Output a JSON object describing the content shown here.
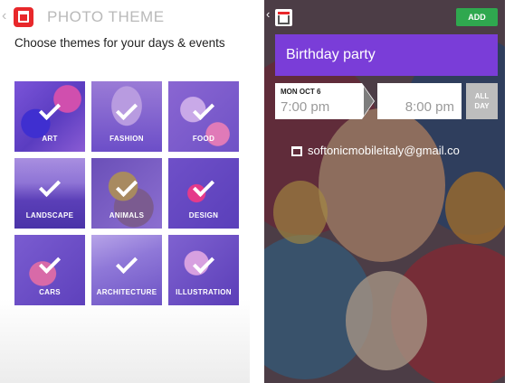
{
  "left_screen": {
    "title": "PHOTO THEME",
    "subtitle": "Choose themes for your days & events",
    "themes": [
      {
        "label": "ART",
        "selected": true
      },
      {
        "label": "FASHION",
        "selected": true
      },
      {
        "label": "FOOD",
        "selected": true
      },
      {
        "label": "LANDSCAPE",
        "selected": true
      },
      {
        "label": "ANIMALS",
        "selected": true
      },
      {
        "label": "DESIGN",
        "selected": true
      },
      {
        "label": "CARS",
        "selected": true
      },
      {
        "label": "ARCHITECTURE",
        "selected": true
      },
      {
        "label": "ILLUSTRATION",
        "selected": true
      }
    ]
  },
  "right_screen": {
    "add_label": "ADD",
    "event_title": "Birthday party",
    "date": "MON OCT 6",
    "start_time": "7:00 pm",
    "end_time": "8:00 pm",
    "all_day_line1": "ALL",
    "all_day_line2": "DAY",
    "account": "softonicmobileitaly@gmail.co"
  },
  "colors": {
    "brand_red": "#e8282b",
    "accent_purple": "#7a3dd8",
    "add_green": "#2fa84f",
    "tile_purple": "#6f52c6"
  },
  "icons": {
    "app_icon": "calendar-app-icon",
    "back": "chevron-left-icon",
    "check": "checkmark-icon",
    "account_calendar": "calendar-icon"
  }
}
